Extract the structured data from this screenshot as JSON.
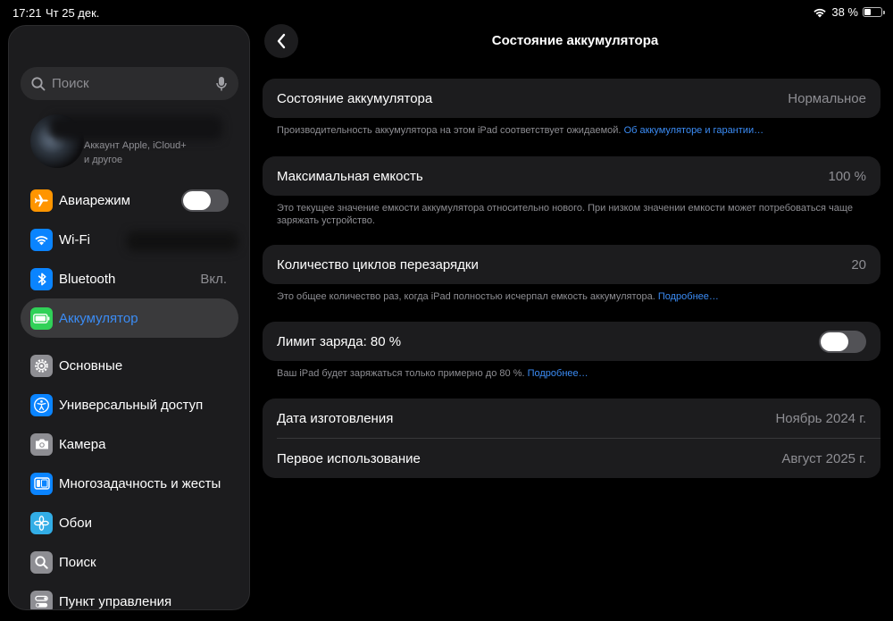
{
  "statusbar": {
    "time": "17:21",
    "date": "Чт 25 дек.",
    "battery_percent": "38 %",
    "battery_level": 0.38
  },
  "sidebar": {
    "search_placeholder": "Поиск",
    "account_sub_line1": "Аккаунт Apple, iCloud+",
    "account_sub_line2": "и другое",
    "items": [
      {
        "label": "Авиарежим",
        "icon": "airplane-icon",
        "color": "#ff9500",
        "toggle": false
      },
      {
        "label": "Wi-Fi",
        "icon": "wifi-icon",
        "color": "#0a84ff"
      },
      {
        "label": "Bluetooth",
        "icon": "bluetooth-icon",
        "color": "#0a84ff",
        "value": "Вкл."
      },
      {
        "label": "Аккумулятор",
        "icon": "battery-icon",
        "color": "#30d158",
        "selected": true
      },
      {
        "label": "Основные",
        "icon": "gear-icon",
        "color": "#8e8e93"
      },
      {
        "label": "Универсальный доступ",
        "icon": "accessibility-icon",
        "color": "#0a84ff"
      },
      {
        "label": "Камера",
        "icon": "camera-icon",
        "color": "#8e8e93"
      },
      {
        "label": "Многозадачность и жесты",
        "icon": "multitasking-icon",
        "color": "#0a84ff"
      },
      {
        "label": "Обои",
        "icon": "wallpaper-icon",
        "color": "#32ade6"
      },
      {
        "label": "Поиск",
        "icon": "search-icon",
        "color": "#8e8e93"
      },
      {
        "label": "Пункт управления",
        "icon": "control-center-icon",
        "color": "#8e8e93"
      }
    ]
  },
  "main": {
    "title": "Состояние аккумулятора",
    "health": {
      "label": "Состояние аккумулятора",
      "value": "Нормальное"
    },
    "health_note": "Производительность аккумулятора на этом iPad соответствует ожидаемой.",
    "health_link": "Об аккумуляторе и гарантии…",
    "capacity": {
      "label": "Максимальная емкость",
      "value": "100 %"
    },
    "capacity_note": "Это текущее значение емкости аккумулятора относительно нового. При низком значении емкости может потребоваться чаще заряжать устройство.",
    "cycles": {
      "label": "Количество циклов перезарядки",
      "value": "20"
    },
    "cycles_note": "Это общее количество раз, когда iPad полностью исчерпал емкость аккумулятора.",
    "cycles_link": "Подробнее…",
    "limit": {
      "label": "Лимит заряда: 80 %",
      "toggle": false
    },
    "limit_note": "Ваш iPad будет заряжаться только примерно до 80 %.",
    "limit_link": "Подробнее…",
    "manufacture": {
      "label": "Дата изготовления",
      "value": "Ноябрь 2024 г."
    },
    "first_use": {
      "label": "Первое использование",
      "value": "Август 2025 г."
    }
  }
}
